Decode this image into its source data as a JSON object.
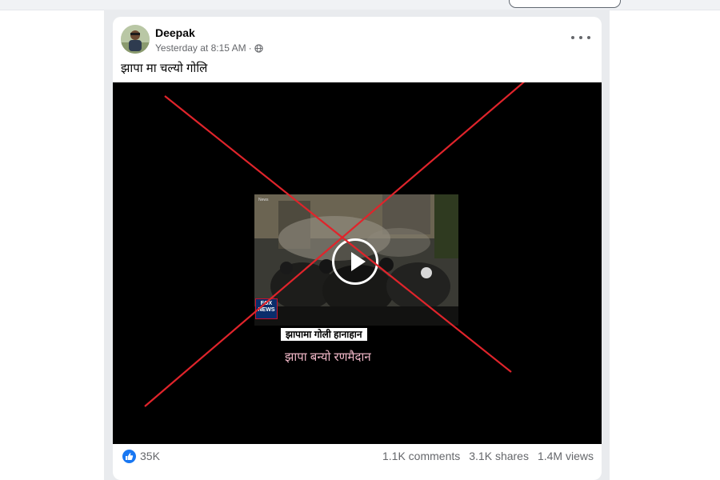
{
  "post": {
    "author": "Deepak",
    "timestamp": "Yesterday at 8:15 AM",
    "separator": "·",
    "privacy_icon": "globe-icon",
    "text": "झापा मा चल्यो गोलि"
  },
  "video": {
    "news_tag": "News",
    "channel_logo_line1": "FOX",
    "channel_logo_line2": "NEWS",
    "caption_box": "झापामा गोली हानाहान",
    "caption": "झापा बन्यो रणमैदान",
    "play_icon": "play-icon",
    "overlay_icon": "red-cross-mark"
  },
  "stats": {
    "likes": "35K",
    "comments": "1.1K comments",
    "shares": "3.1K shares",
    "views": "1.4M views",
    "like_icon": "thumbs-up-icon",
    "like_color": "#1877f2"
  },
  "colors": {
    "background": "#f0f2f5",
    "card": "#ffffff",
    "cross": "#e0242b",
    "text_secondary": "#65676b"
  }
}
